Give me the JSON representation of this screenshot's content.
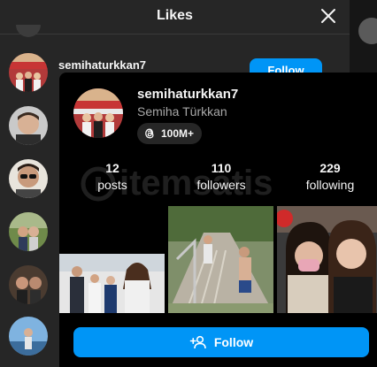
{
  "likes_dialog": {
    "title": "Likes",
    "first_like": {
      "username": "semihaturkkan7",
      "follow_label": "Follow"
    }
  },
  "hover_card": {
    "username": "semihaturkkan7",
    "full_name": "Semiha Türkkan",
    "threads_count": "100M+",
    "stats": {
      "posts": {
        "value": "12",
        "label": "posts"
      },
      "followers": {
        "value": "110",
        "label": "followers"
      },
      "following": {
        "value": "229",
        "label": "following"
      }
    },
    "follow_label": "Follow",
    "watermark_text": "itemsatis"
  },
  "colors": {
    "accent": "#0095f6",
    "card_bg": "#000000",
    "dialog_bg": "#262626"
  }
}
